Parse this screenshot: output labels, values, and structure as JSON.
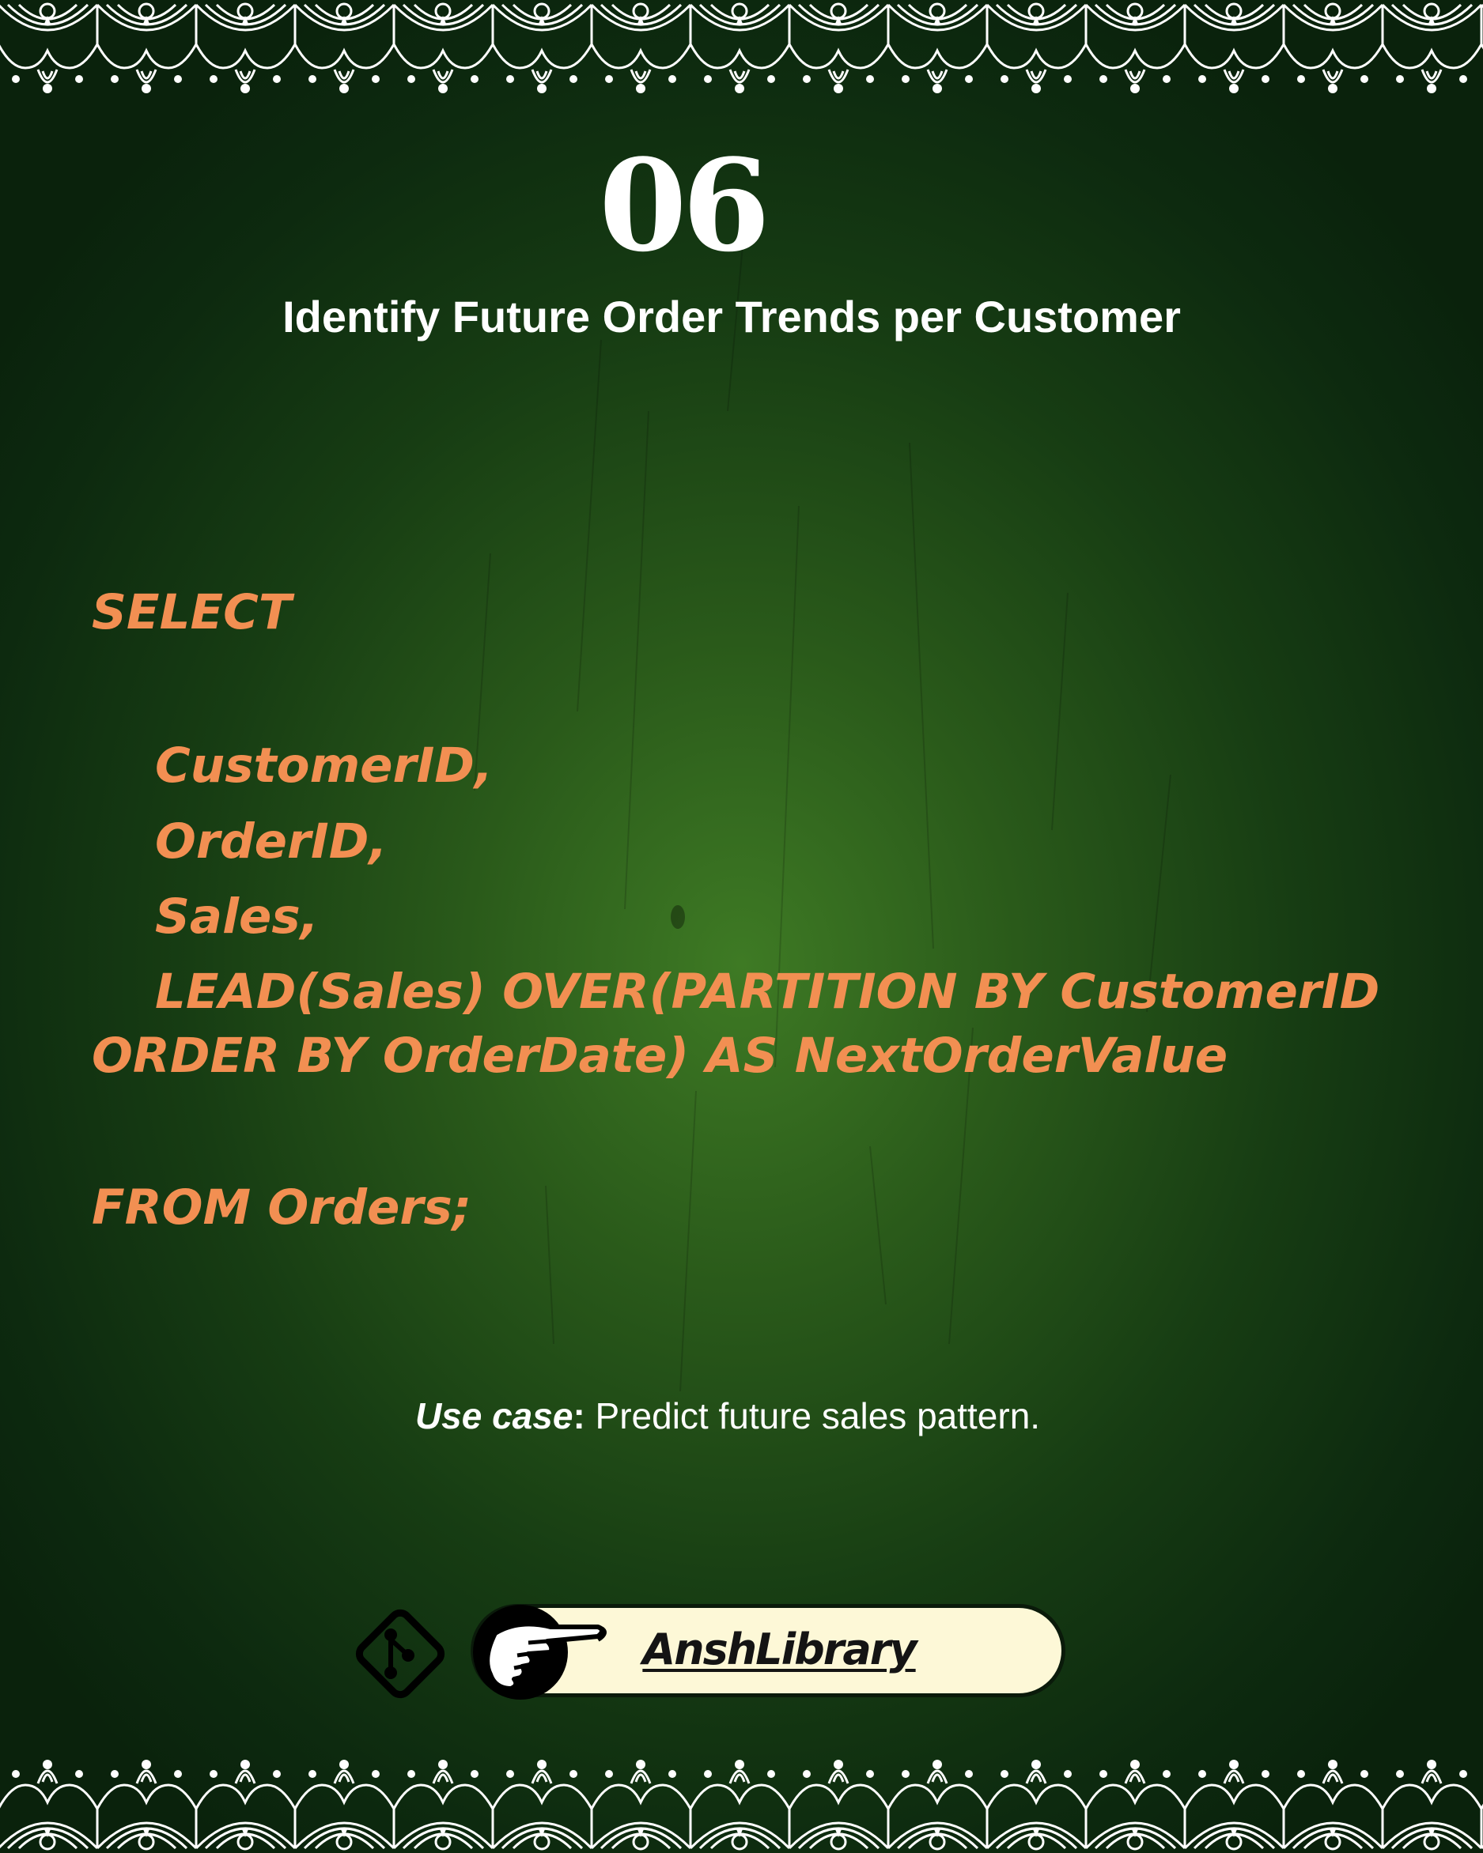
{
  "slide": {
    "number": "06",
    "title": "Identify Future Order Trends per Customer"
  },
  "code": {
    "lines": [
      "SELECT",
      "CustomerID,",
      "OrderID,",
      "Sales,",
      "LEAD(Sales) OVER(PARTITION BY CustomerID",
      "ORDER BY OrderDate) AS NextOrderValue",
      "FROM Orders;"
    ]
  },
  "use_case": {
    "label": "Use case",
    "separator": ":",
    "text": " Predict future sales pattern."
  },
  "footer": {
    "brand": "AnshLibrary",
    "icons": [
      "git-icon",
      "pointing-hand-icon"
    ]
  },
  "colors": {
    "background": "#1e4a16",
    "code": "#f28f52",
    "text": "#ffffff",
    "pill": "#fdf8d7"
  }
}
